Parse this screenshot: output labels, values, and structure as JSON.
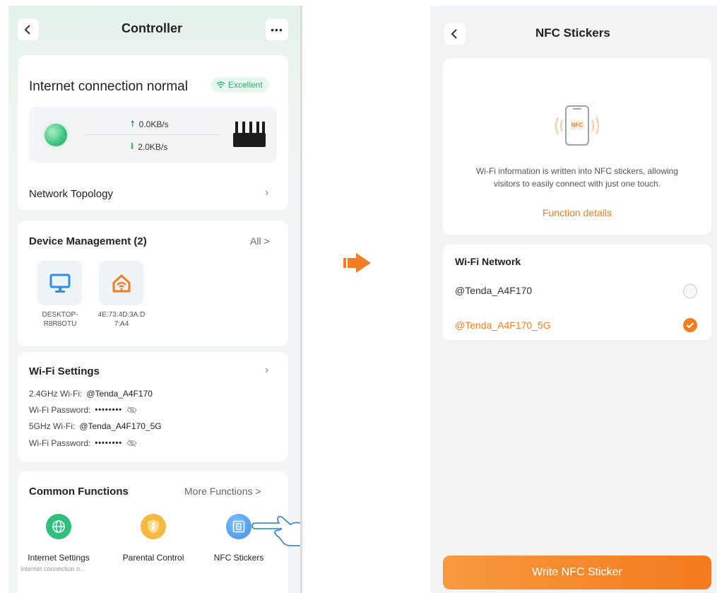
{
  "left_screen": {
    "header": {
      "back_icon": "chevron-left-icon",
      "title": "Controller",
      "more_icon": "more-dots-icon"
    },
    "connection": {
      "status": "Internet connection normal",
      "quality_badge": "Excellent",
      "upload_speed": "0.0KB/s",
      "download_speed": "2.0KB/s"
    },
    "network_topology": {
      "label": "Network Topology"
    },
    "device_management": {
      "title": "Device Management (2)",
      "all_link": "All >",
      "devices": [
        {
          "name_line1": "DESKTOP-",
          "name_line2": "R8R8OTU",
          "icon": "monitor-icon"
        },
        {
          "name_line1": "4E:73:4D:3A:D",
          "name_line2": "7:A4",
          "icon": "wifi-home-icon"
        }
      ]
    },
    "wifi_settings": {
      "title": "Wi-Fi Settings",
      "rows": [
        {
          "label": "2.4GHz Wi-Fi:",
          "value": "@Tenda_A4F170"
        },
        {
          "label": "Wi-Fi Password:",
          "value": "••••••••"
        },
        {
          "label": "5GHz Wi-Fi:",
          "value": "@Tenda_A4F170_5G"
        },
        {
          "label": "Wi-Fi Password:",
          "value": "••••••••"
        }
      ]
    },
    "common_functions": {
      "title": "Common Functions",
      "more_link": "More Functions >",
      "items": [
        {
          "label": "Internet Settings",
          "sub": "Internet connection n...",
          "icon": "globe-icon",
          "color": "#2fbf7d"
        },
        {
          "label": "Parental Control",
          "sub": "",
          "icon": "child-shield-icon",
          "color": "#f5b841"
        },
        {
          "label": "NFC Stickers",
          "sub": "",
          "icon": "nfc-icon",
          "color": "#3a8ee6"
        }
      ]
    }
  },
  "right_screen": {
    "header": {
      "back_icon": "chevron-left-icon",
      "title": "NFC Stickers"
    },
    "info": {
      "phone_label": "NFC",
      "description_line1": "Wi-Fi information is written into NFC stickers, allowing",
      "description_line2": "visitors to easily connect with just one touch.",
      "details_link": "Function details"
    },
    "wifi_network": {
      "title": "Wi-Fi Network",
      "options": [
        {
          "ssid": "@Tenda_A4F170",
          "selected": false
        },
        {
          "ssid": "@Tenda_A4F170_5G",
          "selected": true
        }
      ]
    },
    "write_button": "Write NFC Sticker"
  },
  "colors": {
    "accent_orange": "#f37d22",
    "accent_green": "#27b36a",
    "nfc_blue": "#3a8ee6"
  }
}
